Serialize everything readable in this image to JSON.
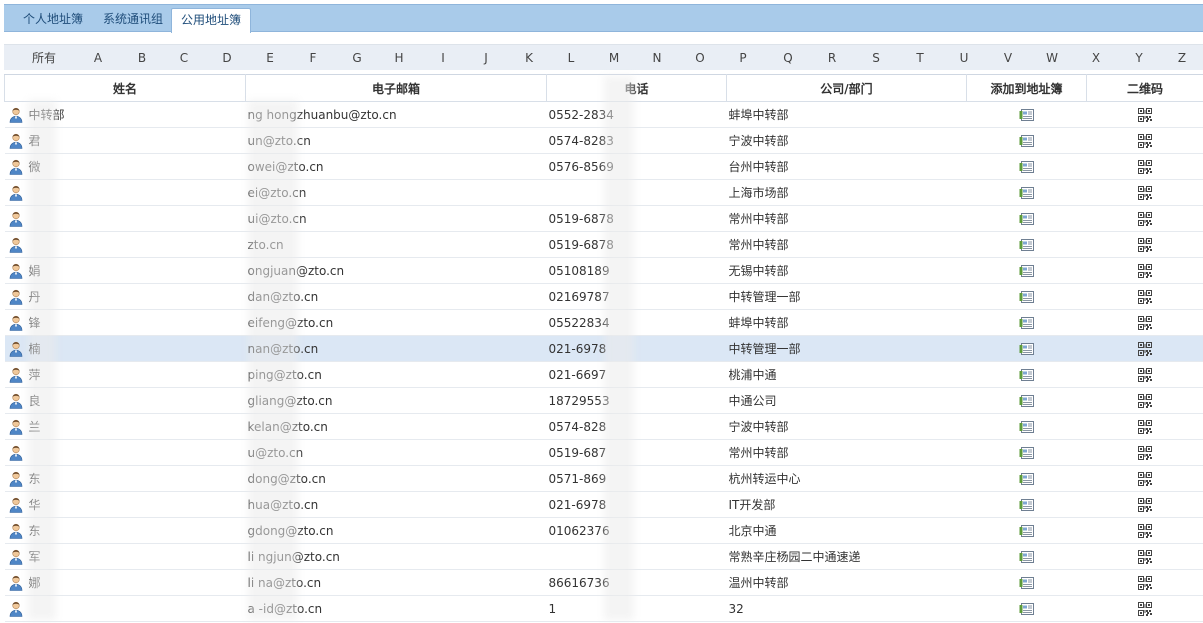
{
  "tabs": [
    {
      "label": "个人地址簿"
    },
    {
      "label": "系统通讯组"
    },
    {
      "label": "公用地址簿"
    }
  ],
  "letters": [
    "所有",
    "A",
    "B",
    "C",
    "D",
    "E",
    "F",
    "G",
    "H",
    "I",
    "J",
    "K",
    "L",
    "M",
    "N",
    "O",
    "P",
    "Q",
    "R",
    "S",
    "T",
    "U",
    "V",
    "W",
    "X",
    "Y",
    "Z"
  ],
  "columns": {
    "name": "姓名",
    "email": "电子邮箱",
    "phone": "电话",
    "dept": "公司/部门",
    "add": "添加到地址簿",
    "qr": "二维码"
  },
  "rows": [
    {
      "name": "中转部",
      "email": "ng   hongzhuanbu@zto.cn",
      "phone": "0552-2834",
      "dept": "蚌埠中转部"
    },
    {
      "name": "君",
      "email": "un@zto.cn",
      "phone": "0574-8283",
      "dept": "宁波中转部"
    },
    {
      "name": "微",
      "email": "owei@zto.cn",
      "phone": "0576-8569",
      "dept": "台州中转部"
    },
    {
      "name": "",
      "email": "ei@zto.cn",
      "phone": "",
      "dept": "上海市场部"
    },
    {
      "name": "",
      "email": "ui@zto.cn",
      "phone": "0519-6878",
      "dept": "常州中转部"
    },
    {
      "name": "",
      "email": "zto.cn",
      "phone": "0519-6878",
      "dept": "常州中转部"
    },
    {
      "name": "娟",
      "email": "ongjuan@zto.cn",
      "phone": "05108189",
      "dept": "无锡中转部"
    },
    {
      "name": "丹",
      "email": "dan@zto.cn",
      "phone": "02169787",
      "dept": "中转管理一部"
    },
    {
      "name": "锋",
      "email": "eifeng@zto.cn",
      "phone": "05522834",
      "dept": "蚌埠中转部"
    },
    {
      "name": "楠",
      "email": "nan@zto.cn",
      "phone": "021-6978",
      "dept": "中转管理一部"
    },
    {
      "name": "萍",
      "email": "ping@zto.cn",
      "phone": "021-6697",
      "dept": "桃浦中通"
    },
    {
      "name": "良",
      "email": "gliang@zto.cn",
      "phone": "18729553",
      "dept": "中通公司"
    },
    {
      "name": "兰",
      "email": "kelan@zto.cn",
      "phone": "0574-828",
      "dept": "宁波中转部"
    },
    {
      "name": "",
      "email": "u@zto.cn",
      "phone": "0519-687",
      "dept": "常州中转部"
    },
    {
      "name": "东",
      "email": "dong@zto.cn",
      "phone": "0571-869",
      "dept": "杭州转运中心"
    },
    {
      "name": "华",
      "email": "hua@zto.cn",
      "phone": "021-6978",
      "dept": "IT开发部"
    },
    {
      "name": "东",
      "email": "gdong@zto.cn",
      "phone": "01062376",
      "dept": "北京中通"
    },
    {
      "name": "军",
      "email": "li   ngjun@zto.cn",
      "phone": "",
      "dept": "常熟辛庄杨园二中通速递"
    },
    {
      "name": "娜",
      "email": "li   na@zto.cn",
      "phone": "86616736",
      "dept": "温州中转部"
    },
    {
      "name": "",
      "email": "a   -id@zto.cn",
      "phone": "1",
      "dept": "32"
    }
  ],
  "selected_row": 9,
  "icons": {
    "person": "person-icon",
    "add": "add-to-addressbook-icon",
    "qr": "qr-code-icon"
  },
  "colors": {
    "tabbar_bg": "#a9cbea",
    "letterbar_bg": "#e9eef5",
    "selected_row": "#dbe7f5"
  }
}
